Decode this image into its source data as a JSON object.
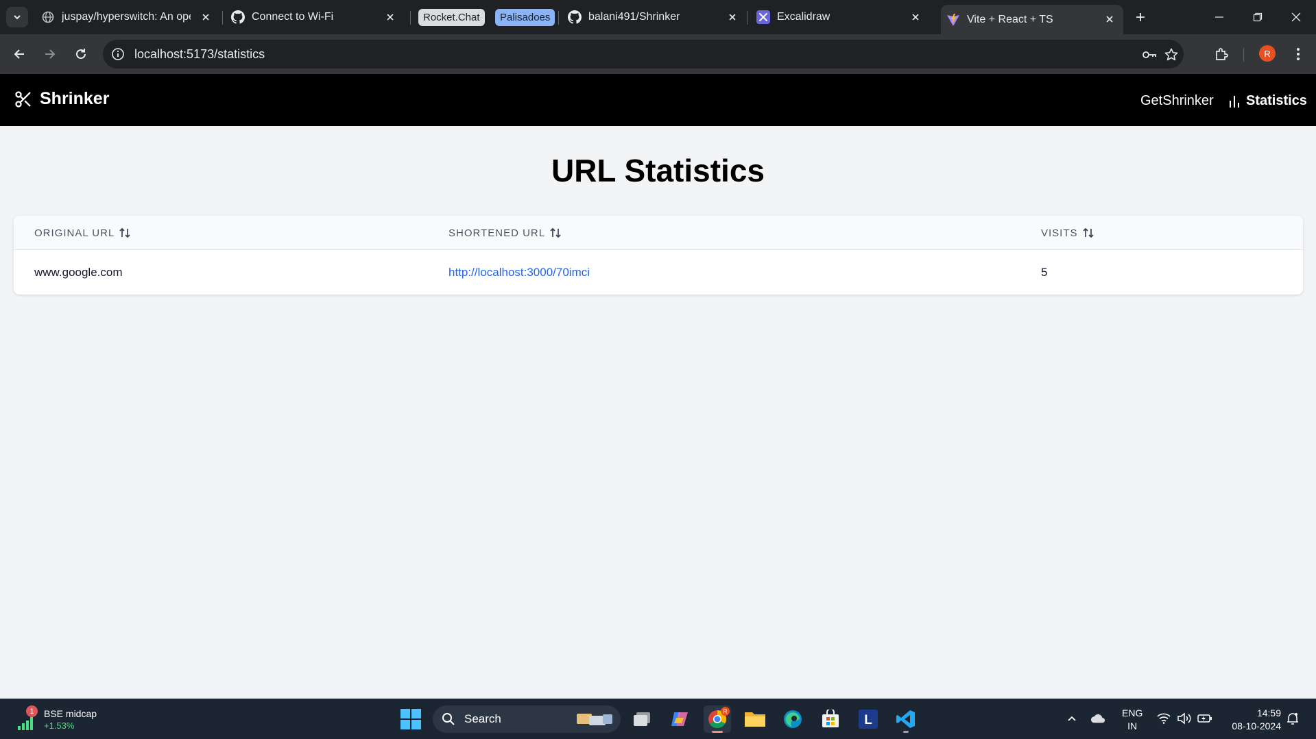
{
  "browser": {
    "tabs": [
      {
        "title": "juspay/hyperswitch: An open",
        "icon": "globe-icon"
      },
      {
        "title": "Connect to Wi-Fi",
        "icon": "github-icon"
      },
      {
        "title": "balani491/Shrinker",
        "icon": "github-icon"
      },
      {
        "title": "Excalidraw",
        "icon": "excalidraw-icon"
      },
      {
        "title": "Vite + React + TS",
        "icon": "vite-icon",
        "active": true
      }
    ],
    "tab_groups": [
      {
        "label": "Rocket.Chat",
        "color": "#dadce0"
      },
      {
        "label": "Palisadoes",
        "color": "#8ab4f8"
      }
    ],
    "address": "localhost:5173/statistics",
    "profile_initial": "R"
  },
  "app": {
    "brand": "Shrinker",
    "nav": {
      "get_shrinker": "GetShrinker",
      "statistics": "Statistics"
    },
    "page_title": "URL Statistics",
    "table": {
      "columns": [
        "ORIGINAL URL",
        "SHORTENED URL",
        "VISITS"
      ],
      "rows": [
        {
          "original": "www.google.com",
          "shortened": "http://localhost:3000/70imci",
          "visits": "5"
        }
      ]
    }
  },
  "taskbar": {
    "widget": {
      "badge": "1",
      "title": "BSE midcap",
      "change": "+1.53%"
    },
    "search_label": "Search",
    "lang": {
      "line1": "ENG",
      "line2": "IN"
    },
    "clock": {
      "time": "14:59",
      "date": "08-10-2024"
    }
  }
}
